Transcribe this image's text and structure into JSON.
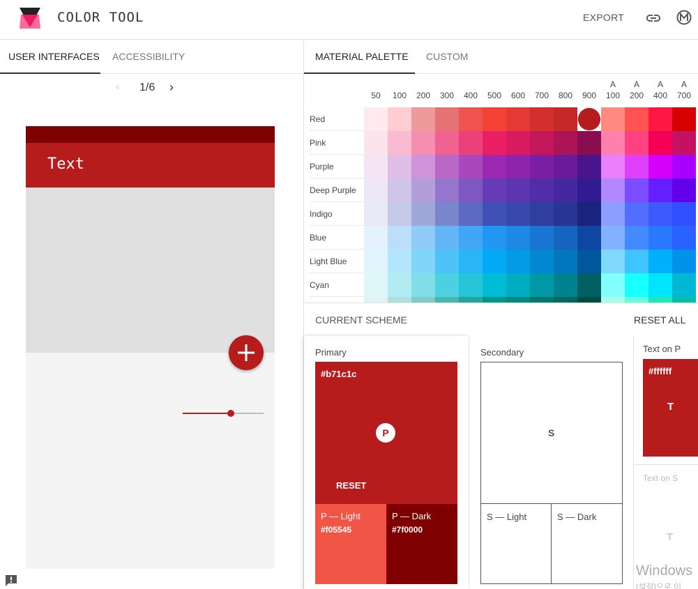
{
  "app": {
    "title": "COLOR TOOL",
    "export_label": "EXPORT",
    "logo_icon": "color-tool-logo",
    "link_icon": "link-icon",
    "account_icon": "m-circle-icon"
  },
  "left_tabs": [
    {
      "label": "USER INTERFACES",
      "active": true
    },
    {
      "label": "ACCESSIBILITY",
      "active": false
    }
  ],
  "pager": {
    "prev": "‹",
    "count": "1/6",
    "next": "›"
  },
  "phone": {
    "app_bar_text": "Text",
    "status_color": "#7f0000",
    "primary_color": "#b71c1c",
    "slider_value_percent": 60
  },
  "right_tabs": [
    {
      "label": "MATERIAL PALETTE",
      "active": true
    },
    {
      "label": "CUSTOM",
      "active": false
    }
  ],
  "palette": {
    "shade_headers": [
      {
        "top": "",
        "bottom": "50"
      },
      {
        "top": "",
        "bottom": "100"
      },
      {
        "top": "",
        "bottom": "200"
      },
      {
        "top": "",
        "bottom": "300"
      },
      {
        "top": "",
        "bottom": "400"
      },
      {
        "top": "",
        "bottom": "500"
      },
      {
        "top": "",
        "bottom": "600"
      },
      {
        "top": "",
        "bottom": "700"
      },
      {
        "top": "",
        "bottom": "800"
      },
      {
        "top": "",
        "bottom": "900"
      },
      {
        "top": "A",
        "bottom": "100"
      },
      {
        "top": "A",
        "bottom": "200"
      },
      {
        "top": "A",
        "bottom": "400"
      },
      {
        "top": "A",
        "bottom": "700"
      }
    ],
    "selected": {
      "row": 0,
      "col": 9
    },
    "rows": [
      {
        "name": "Red",
        "colors": [
          "#ffebee",
          "#ffcdd2",
          "#ef9a9a",
          "#e57373",
          "#ef5350",
          "#f44336",
          "#e53935",
          "#d32f2f",
          "#c62828",
          "#b71c1c",
          "#ff8a80",
          "#ff5252",
          "#ff1744",
          "#d50000"
        ]
      },
      {
        "name": "Pink",
        "colors": [
          "#fce4ec",
          "#f8bbd0",
          "#f48fb1",
          "#f06292",
          "#ec407a",
          "#e91e63",
          "#d81b60",
          "#c2185b",
          "#ad1457",
          "#880e4f",
          "#ff80ab",
          "#ff4081",
          "#f50057",
          "#c51162"
        ]
      },
      {
        "name": "Purple",
        "colors": [
          "#f3e5f5",
          "#e1bee7",
          "#ce93d8",
          "#ba68c8",
          "#ab47bc",
          "#9c27b0",
          "#8e24aa",
          "#7b1fa2",
          "#6a1b9a",
          "#4a148c",
          "#ea80fc",
          "#e040fb",
          "#d500f9",
          "#aa00ff"
        ]
      },
      {
        "name": "Deep Purple",
        "colors": [
          "#ede7f6",
          "#d1c4e9",
          "#b39ddb",
          "#9575cd",
          "#7e57c2",
          "#673ab7",
          "#5e35b1",
          "#512da8",
          "#4527a0",
          "#311b92",
          "#b388ff",
          "#7c4dff",
          "#651fff",
          "#6200ea"
        ]
      },
      {
        "name": "Indigo",
        "colors": [
          "#e8eaf6",
          "#c5cae9",
          "#9fa8da",
          "#7986cb",
          "#5c6bc0",
          "#3f51b5",
          "#3949ab",
          "#303f9f",
          "#283593",
          "#1a237e",
          "#8c9eff",
          "#536dfe",
          "#3d5afe",
          "#304ffe"
        ]
      },
      {
        "name": "Blue",
        "colors": [
          "#e3f2fd",
          "#bbdefb",
          "#90caf9",
          "#64b5f6",
          "#42a5f5",
          "#2196f3",
          "#1e88e5",
          "#1976d2",
          "#1565c0",
          "#0d47a1",
          "#82b1ff",
          "#448aff",
          "#2979ff",
          "#2962ff"
        ]
      },
      {
        "name": "Light Blue",
        "colors": [
          "#e1f5fe",
          "#b3e5fc",
          "#81d4fa",
          "#4fc3f7",
          "#29b6f6",
          "#03a9f4",
          "#039be5",
          "#0288d1",
          "#0277bd",
          "#01579b",
          "#80d8ff",
          "#40c4ff",
          "#00b0ff",
          "#0091ea"
        ]
      },
      {
        "name": "Cyan",
        "colors": [
          "#e0f7fa",
          "#b2ebf2",
          "#80deea",
          "#4dd0e1",
          "#26c6da",
          "#00bcd4",
          "#00acc1",
          "#0097a7",
          "#00838f",
          "#006064",
          "#84ffff",
          "#18ffff",
          "#00e5ff",
          "#00b8d4"
        ]
      },
      {
        "name": "",
        "colors": [
          "#e0f2f1",
          "#b2dfdb",
          "#80cbc4",
          "#4db6ac",
          "#26a69a",
          "#009688",
          "#00897b",
          "#00796b",
          "#00695c",
          "#004d40",
          "#a7ffeb",
          "#64ffda",
          "#1de9b6",
          "#00bfa5"
        ]
      }
    ]
  },
  "current_scheme": {
    "label": "CURRENT SCHEME",
    "reset_all": "RESET ALL"
  },
  "primary": {
    "title": "Primary",
    "hex": "#b71c1c",
    "badge": "P",
    "reset": "RESET",
    "light_title": "P — Light",
    "light_hex": "#f05545",
    "dark_title": "P — Dark",
    "dark_hex": "#7f0000"
  },
  "secondary": {
    "title": "Secondary",
    "letter": "S",
    "light_title": "S — Light",
    "dark_title": "S — Dark"
  },
  "text_colors": {
    "on_p_label": "Text on P",
    "on_p_hex": "#ffffff",
    "on_p_letter": "T",
    "on_s_label": "Text on S",
    "on_s_letter": "T"
  },
  "watermark": {
    "line1": "Windows",
    "line2": "[설정]으로 이"
  }
}
